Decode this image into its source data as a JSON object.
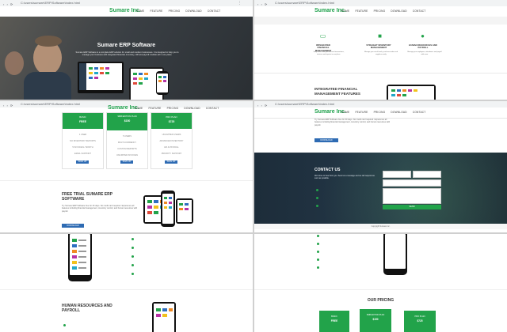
{
  "browser": {
    "url_top_left": "C:\\users\\sumare\\ERP\\Software\\index.html",
    "url_top_right": "C:\\users\\sumare\\ERP\\Software\\index.html",
    "url_bottom_left": "C:\\users\\sumare\\ERP\\Software\\index.html",
    "url_bottom_right": "C:\\users\\sumare\\ERP\\Software\\index.html"
  },
  "brand": "Sumare Inc.",
  "menu": [
    "HOME",
    "FEATURE",
    "PRICING",
    "DOWNLOAD",
    "CONTACT"
  ],
  "hero": {
    "title": "Sumare ERP Software",
    "subtitle": "Sumare ERP Software is a complete ERP solution for small and medium businesses. It is designed to help you to manage your business with integrated financial, inventory, HR and payroll modules all in one place."
  },
  "features": [
    {
      "icon": "money-icon",
      "title": "INTEGRATED FINANCIAL MANAGEMENT",
      "text": "Keep track of all your financial transactions, invoices and reports in one place."
    },
    {
      "icon": "truck-icon",
      "title": "STRAIGHT INVENTORY MANAGEMENT",
      "text": "Manage your stock levels, purchase orders and suppliers easily."
    },
    {
      "icon": "people-icon",
      "title": "HUMAN RESOURCES AND PAYROLL",
      "text": "Manage your employees, attendance and payroll with ease."
    }
  ],
  "financial_section": {
    "title": "INTEGRATED FINANCIAL MANAGEMENT FEATURES"
  },
  "pricing_cards": [
    {
      "name": "BASIC",
      "price": "FREE",
      "lines": [
        "1 USER",
        "NO INVENTORY REPORTS",
        "5 INVOICES / MONTH",
        "EMAIL SUPPORT"
      ],
      "button": "SIGN UP"
    },
    {
      "name": "SMB EDITION PLAN",
      "price": "$150",
      "lines": [
        "5 USERS",
        "MULTI-CURRENCY",
        "CUSTOM REPORTS",
        "UNLIMITED INVOICES"
      ],
      "button": "SIGN UP"
    },
    {
      "name": "PRO PLAN",
      "price": "$725",
      "lines": [
        "UNLIMITED USERS",
        "ADVANCED INVENTORY",
        "HR & PAYROLL",
        "PRIORITY SUPPORT"
      ],
      "button": "SIGN UP"
    }
  ],
  "trial": {
    "title": "FREE TRIAL SUMARE ERP SOFTWARE",
    "text": "Try Sumare ERP Software free for 30 days. No credit card required. Experience all features including financial management, inventory control, and human resources with payroll.",
    "button": "DOWNLOAD"
  },
  "hr_section": {
    "title": "HUMAN RESOURCES AND PAYROLL"
  },
  "download_button": "DOWNLOAD",
  "contact": {
    "title": "CONTACT US",
    "text": "We'd love to hear from you. Send us a message and we will respond as soon as possible.",
    "button": "SEND",
    "copyright": "Copyright Sumare Inc."
  },
  "pricing_title": "OUR PRICING",
  "pricing_bottom": [
    {
      "name": "BASIC",
      "price": "FREE"
    },
    {
      "name": "SMB EDITION PLAN",
      "price": "$150"
    },
    {
      "name": "PRO PLAN",
      "price": "$725"
    }
  ]
}
